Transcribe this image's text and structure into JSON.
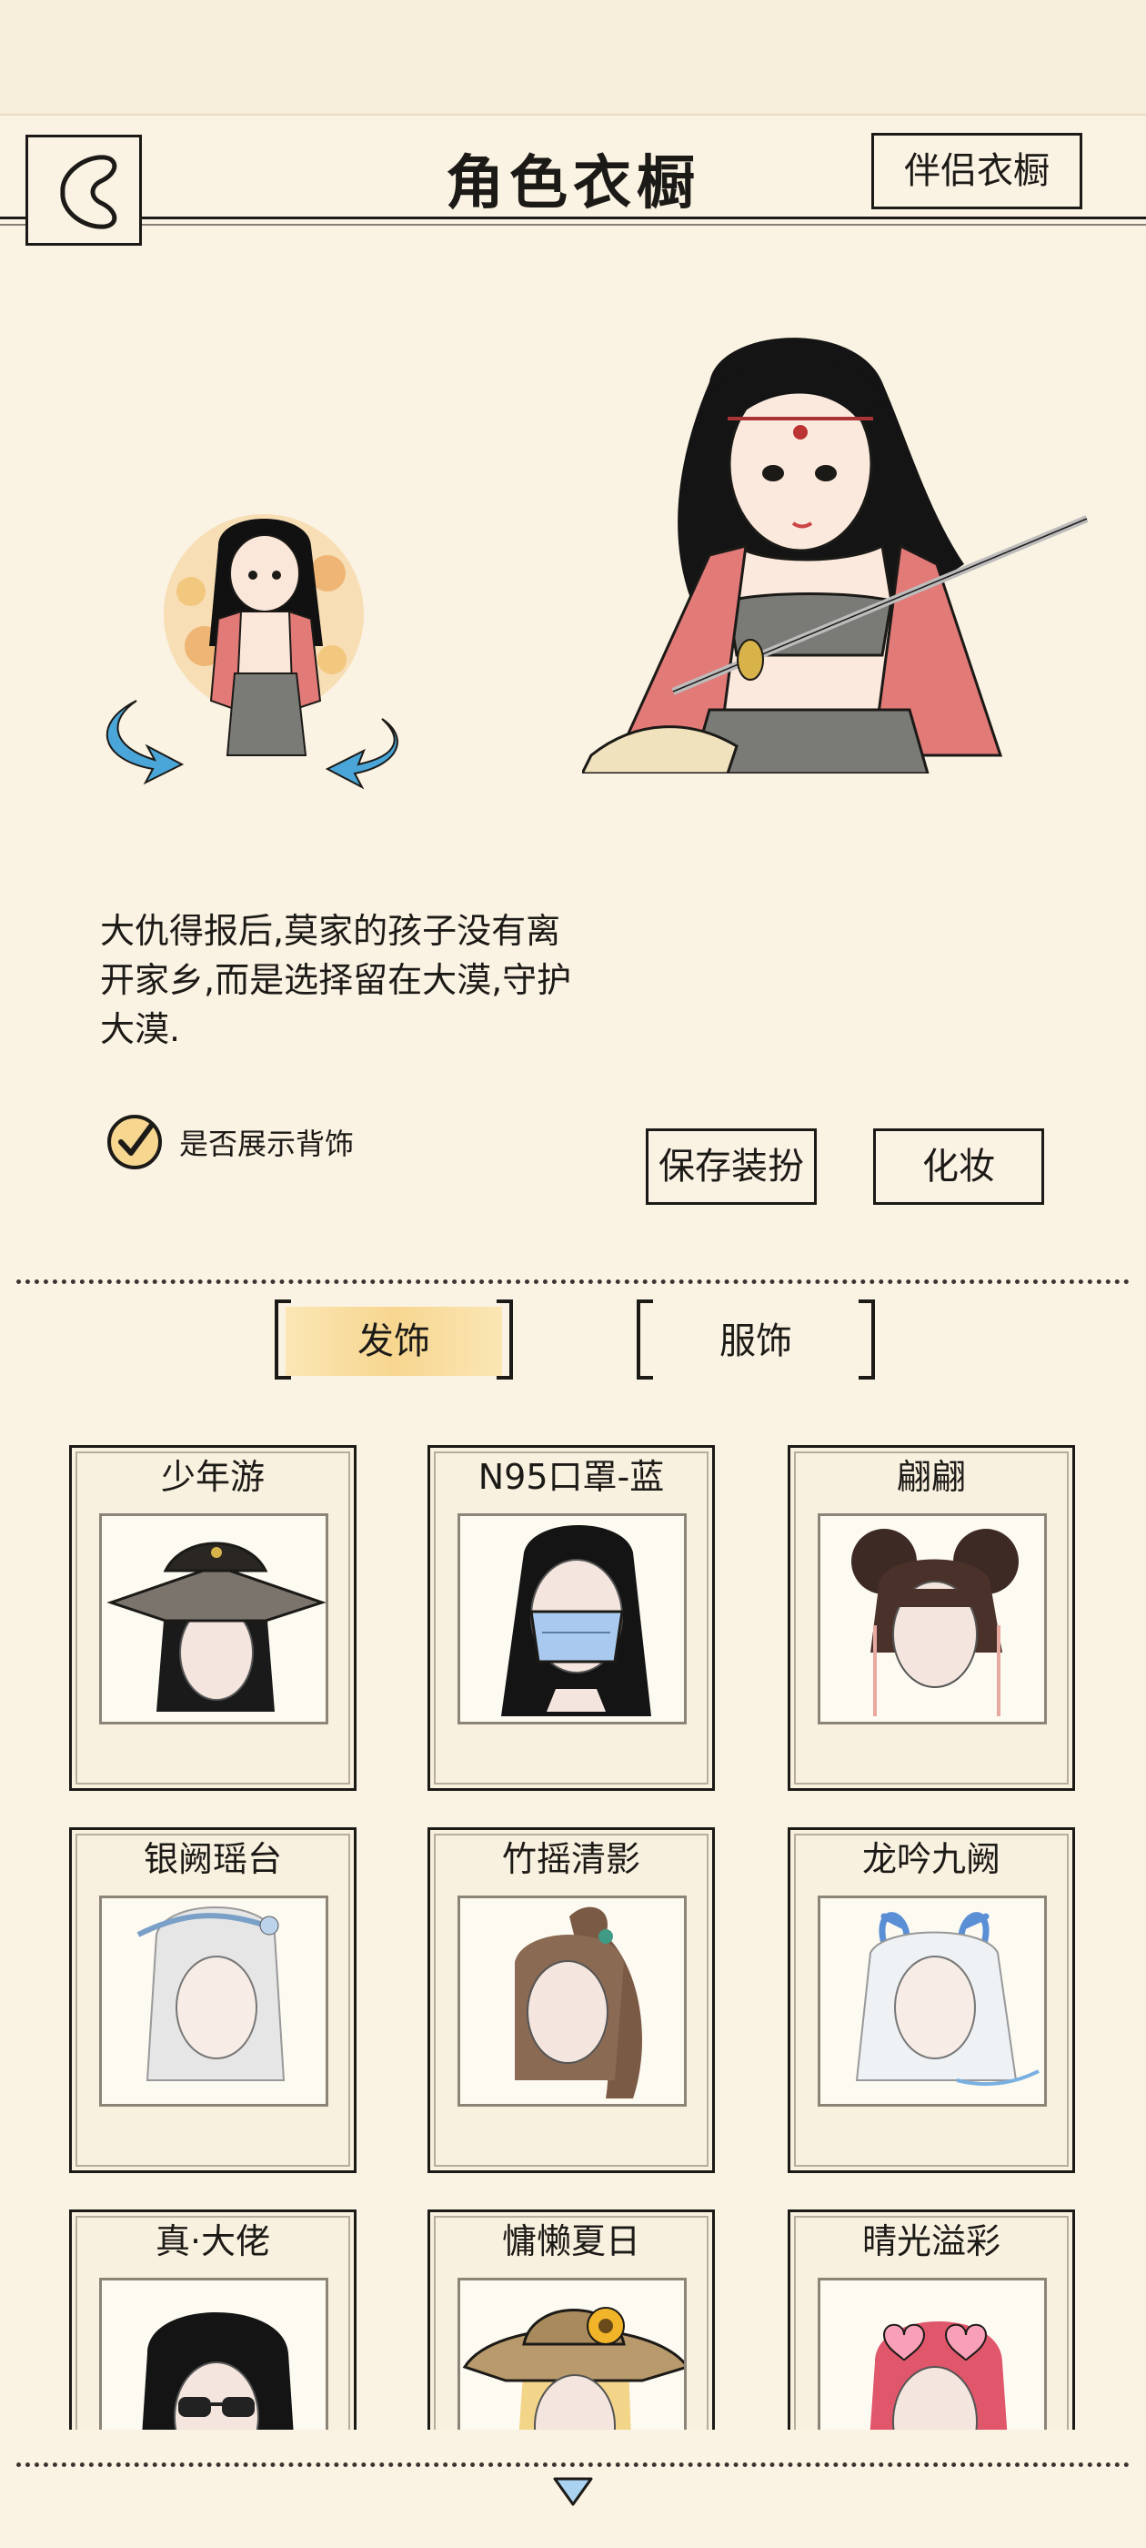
{
  "header": {
    "title": "角色衣橱",
    "partner_button": "伴侣衣橱"
  },
  "character": {
    "description": "大仇得报后,莫家的孩子没有离开家乡,而是选择留在大漠,守护大漠."
  },
  "controls": {
    "show_back_accessory_label": "是否展示背饰",
    "show_back_accessory_checked": true,
    "save_button": "保存装扮",
    "makeup_button": "化妆"
  },
  "tabs": [
    {
      "label": "发饰",
      "active": true
    },
    {
      "label": "服饰",
      "active": false
    }
  ],
  "items": [
    {
      "name": "少年游",
      "icon": "hat-hair-icon"
    },
    {
      "name": "N95口罩-蓝",
      "icon": "mask-hair-icon"
    },
    {
      "name": "翩翩",
      "icon": "buns-hair-icon"
    },
    {
      "name": "银阙瑶台",
      "icon": "silver-hair-icon"
    },
    {
      "name": "竹摇清影",
      "icon": "ponytail-hair-icon"
    },
    {
      "name": "龙吟九阙",
      "icon": "dragon-horn-hair-icon"
    },
    {
      "name": "真·大佬",
      "icon": "sunglasses-hair-icon"
    },
    {
      "name": "慵懒夏日",
      "icon": "straw-hat-hair-icon"
    },
    {
      "name": "晴光溢彩",
      "icon": "heart-glasses-hair-icon"
    }
  ],
  "colors": {
    "background": "#faf2e2",
    "ink": "#1c1a17",
    "active_tab": "#f7d690",
    "rotate_arrow": "#4aa6d8",
    "robe": "#e27a78"
  }
}
